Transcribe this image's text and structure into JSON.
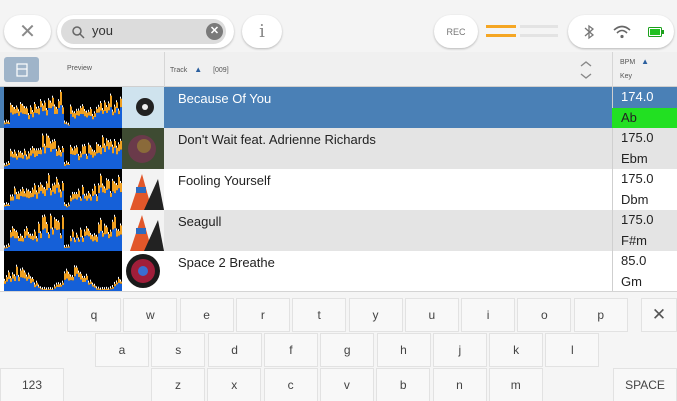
{
  "search": {
    "query": "you",
    "clear_label": "✕"
  },
  "topbar": {
    "info_label": "i",
    "rec_label": "REC",
    "close_label": "✕"
  },
  "meter": {
    "accent_color": "#f5a623",
    "idle_color": "#e3e3e3"
  },
  "header": {
    "preview_label": "Preview",
    "track_label": "Track",
    "track_count": "[009]",
    "bpm_label": "BPM",
    "key_label": "Key",
    "sort_arrow": "▲"
  },
  "tracks": [
    {
      "title": "Because Of You",
      "bpm": "174.0",
      "key": "Ab",
      "selected": true,
      "art_color": "#9fc6d8"
    },
    {
      "title": "Don't Wait feat. Adrienne Richards",
      "bpm": "175.0",
      "key": "Ebm",
      "selected": false,
      "art_color": "#4a5b3a"
    },
    {
      "title": "Fooling Yourself",
      "bpm": "175.0",
      "key": "Dbm",
      "selected": false,
      "art_color": "#e06a2a"
    },
    {
      "title": "Seagull",
      "bpm": "175.0",
      "key": "F#m",
      "selected": false,
      "art_color": "#e06a2a"
    },
    {
      "title": "Space 2 Breathe",
      "bpm": "85.0",
      "key": "Gm",
      "selected": false,
      "art_color": "#b0243a"
    }
  ],
  "colors": {
    "selected_row": "#4a80b6",
    "selected_key": "#22e022",
    "row_light": "#ffffff",
    "row_dark": "#e4e4e4",
    "wave_blue": "#1560d8",
    "wave_orange": "#f0a020",
    "header_grip": "#9fb4c9"
  },
  "keyboard": {
    "row1": [
      "q",
      "w",
      "e",
      "r",
      "t",
      "y",
      "u",
      "i",
      "o",
      "p"
    ],
    "row2": [
      "a",
      "s",
      "d",
      "f",
      "g",
      "h",
      "j",
      "k",
      "l"
    ],
    "row3": [
      "z",
      "x",
      "c",
      "v",
      "b",
      "n",
      "m"
    ],
    "numbers_label": "123",
    "space_label": "SPACE",
    "backspace_label": "✕"
  }
}
